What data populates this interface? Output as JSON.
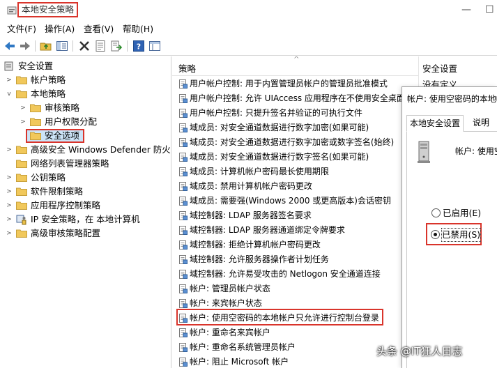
{
  "window": {
    "title": "本地安全策略",
    "minimize": "—",
    "maximize": "☐"
  },
  "menu": [
    "文件(F)",
    "操作(A)",
    "查看(V)",
    "帮助(H)"
  ],
  "tree": {
    "root": "安全设置",
    "items": [
      {
        "label": "帐户策略"
      },
      {
        "label": "本地策略"
      },
      {
        "label": "审核策略"
      },
      {
        "label": "用户权限分配"
      },
      {
        "label": "安全选项"
      },
      {
        "label": "高级安全 Windows Defender 防火墙"
      },
      {
        "label": "网络列表管理器策略"
      },
      {
        "label": "公钥策略"
      },
      {
        "label": "软件限制策略"
      },
      {
        "label": "应用程序控制策略"
      },
      {
        "label": "IP 安全策略，在 本地计算机"
      },
      {
        "label": "高级审核策略配置"
      }
    ]
  },
  "list": {
    "column_policy": "策略",
    "column_setting": "安全设置",
    "rows": [
      "用户帐户控制: 用于内置管理员帐户的管理员批准模式",
      "用户帐户控制: 允许 UIAccess 应用程序在不使用安全桌面",
      "用户帐户控制: 只提升签名并验证的可执行文件",
      "域成员: 对安全通道数据进行数字加密(如果可能)",
      "域成员: 对安全通道数据进行数字加密或数字签名(始终)",
      "域成员: 对安全通道数据进行数字签名(如果可能)",
      "域成员: 计算机帐户密码最长使用期限",
      "域成员: 禁用计算机帐户密码更改",
      "域成员: 需要强(Windows 2000 或更高版本)会话密钥",
      "域控制器: LDAP 服务器签名要求",
      "域控制器: LDAP 服务器通道绑定令牌要求",
      "域控制器: 拒绝计算机帐户密码更改",
      "域控制器: 允许服务器操作者计划任务",
      "域控制器: 允许易受攻击的 Netlogon 安全通道连接",
      "帐户: 管理员帐户状态",
      "帐户: 来宾帐户状态",
      "帐户: 使用空密码的本地帐户只允许进行控制台登录",
      "帐户: 重命名来宾帐户",
      "帐户: 重命名系统管理员帐户",
      "帐户: 阻止 Microsoft 帐户"
    ],
    "first_setting_value": "没有定义"
  },
  "dialog": {
    "title": "帐户: 使用空密码的本地帐",
    "tab_local": "本地安全设置",
    "tab_explain": "说明",
    "description": "帐户: 使用空",
    "radio_enabled": "已启用(E)",
    "radio_disabled": "已禁用(S)",
    "selected": "disabled"
  },
  "watermark": "头条 @IT狂人日志"
}
